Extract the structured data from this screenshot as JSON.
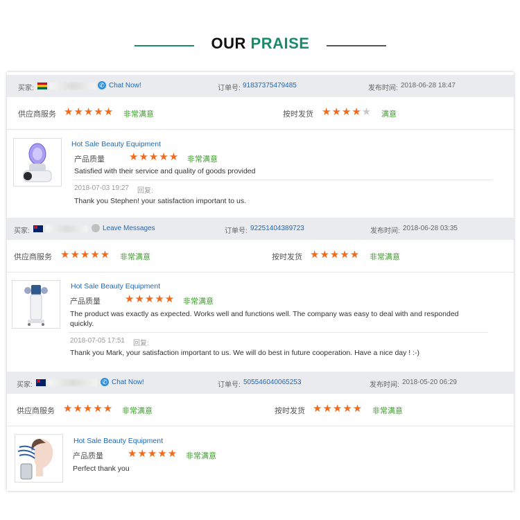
{
  "header": {
    "title_part1": "OUR",
    "title_part2": "PRAISE"
  },
  "labels": {
    "buyer": "买家:",
    "order_no": "订单号:",
    "post_time": "发布时间:",
    "supplier_service": "供应商服务",
    "on_time_shipping": "按时发货",
    "product_quality": "产品质量",
    "reply": "回复:"
  },
  "reviews": [
    {
      "buyer_country": "Ghana",
      "contact_label": "Chat Now!",
      "order_number": "91837375479485",
      "post_time": "2018-06-28 18:47",
      "supplier_service_stars": 5,
      "supplier_service_text": "非常满意",
      "shipping_stars": 4,
      "shipping_text": "满意",
      "product_name": "Hot Sale Beauty Equipment",
      "quality_stars": 5,
      "quality_text": "非常满意",
      "comment": "Satisfied with their service and quality of goods provided",
      "reply_date": "2018-07-03 19:27",
      "reply_text": "Thank you Stephen! your satisfaction important to us."
    },
    {
      "buyer_country": "Australia",
      "contact_label": "Leave Messages",
      "order_number": "92251404389723",
      "post_time": "2018-06-28 03:35",
      "supplier_service_stars": 5,
      "supplier_service_text": "非常满意",
      "shipping_stars": 5,
      "shipping_text": "非常满意",
      "product_name": "Hot Sale Beauty Equipment",
      "quality_stars": 5,
      "quality_text": "非常满意",
      "comment": "The product was exactly as expected. Works well and functions well. The company was easy to deal with and responded quickly.",
      "reply_date": "2018-07-05 17:51",
      "reply_text": "Thank you Mark, your satisfaction important to us. We will do best in future cooperation. Have a nice day ! :-)"
    },
    {
      "buyer_country": "Australia",
      "contact_label": "Chat Now!",
      "order_number": "505546040065253",
      "post_time": "2018-05-20 06:29",
      "supplier_service_stars": 5,
      "supplier_service_text": "非常满意",
      "shipping_stars": 5,
      "shipping_text": "非常满意",
      "product_name": "Hot Sale Beauty Equipment",
      "quality_stars": 5,
      "quality_text": "非常满意",
      "comment": "Perfect thank you"
    }
  ],
  "colors": {
    "accent_green": "#1a8a6a",
    "star_orange": "#f26a1b",
    "link_blue": "#1f68b8",
    "rating_green": "#3c9b2b"
  }
}
